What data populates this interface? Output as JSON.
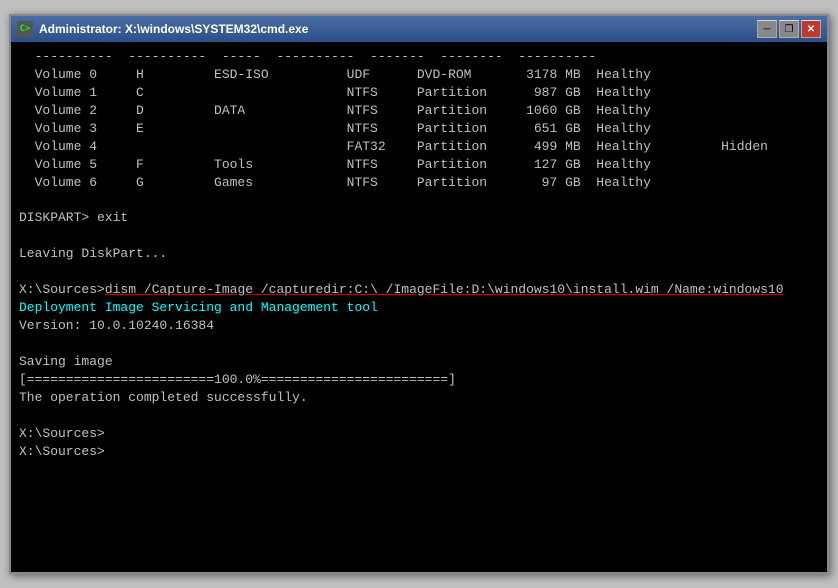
{
  "window": {
    "title": "Administrator: X:\\windows\\SYSTEM32\\cmd.exe",
    "icon_label": "C>"
  },
  "titlebar": {
    "minimize": "─",
    "restore": "❐",
    "close": "✕"
  },
  "terminal": {
    "separator": "  ----------  ----------  -----  ----------  -------  --------  ----------",
    "volumes": [
      {
        "num": "0",
        "letter": "H",
        "label": "ESD-ISO",
        "fs": "UDF",
        "type": "DVD-ROM",
        "size": "3178 MB",
        "status": "Healthy",
        "flag": ""
      },
      {
        "num": "1",
        "letter": "C",
        "label": "",
        "fs": "NTFS",
        "type": "Partition",
        "size": " 987 GB",
        "status": "Healthy",
        "flag": ""
      },
      {
        "num": "2",
        "letter": "D",
        "label": "DATA",
        "fs": "NTFS",
        "type": "Partition",
        "size": "1060 GB",
        "status": "Healthy",
        "flag": ""
      },
      {
        "num": "3",
        "letter": "E",
        "label": "",
        "fs": "NTFS",
        "type": "Partition",
        "size": " 651 GB",
        "status": "Healthy",
        "flag": ""
      },
      {
        "num": "4",
        "letter": "",
        "label": "",
        "fs": "FAT32",
        "type": "Partition",
        "size": " 499 MB",
        "status": "Healthy",
        "flag": "Hidden"
      },
      {
        "num": "5",
        "letter": "F",
        "label": "Tools",
        "fs": "NTFS",
        "type": "Partition",
        "size": " 127 GB",
        "status": "Healthy",
        "flag": ""
      },
      {
        "num": "6",
        "letter": "G",
        "label": "Games",
        "fs": "NTFS",
        "type": "Partition",
        "size": "  97 GB",
        "status": "Healthy",
        "flag": ""
      }
    ],
    "diskpart_exit": "DISKPART> exit",
    "leaving": "Leaving DiskPart...",
    "dism_prompt": "X:\\Sources>",
    "dism_cmd": "dism /Capture-Image /capturedir:C:\\ /ImageFile:D:\\windows10\\install.wim /Name:windows10",
    "dism_tool_line": "Deployment Image Servicing and Management tool",
    "dism_version": "Version: 10.0.10240.16384",
    "saving": "Saving image",
    "progress": "[========================100.0%========================]",
    "success": "The operation completed successfully.",
    "prompt1": "X:\\Sources>",
    "prompt2": "X:\\Sources>"
  }
}
